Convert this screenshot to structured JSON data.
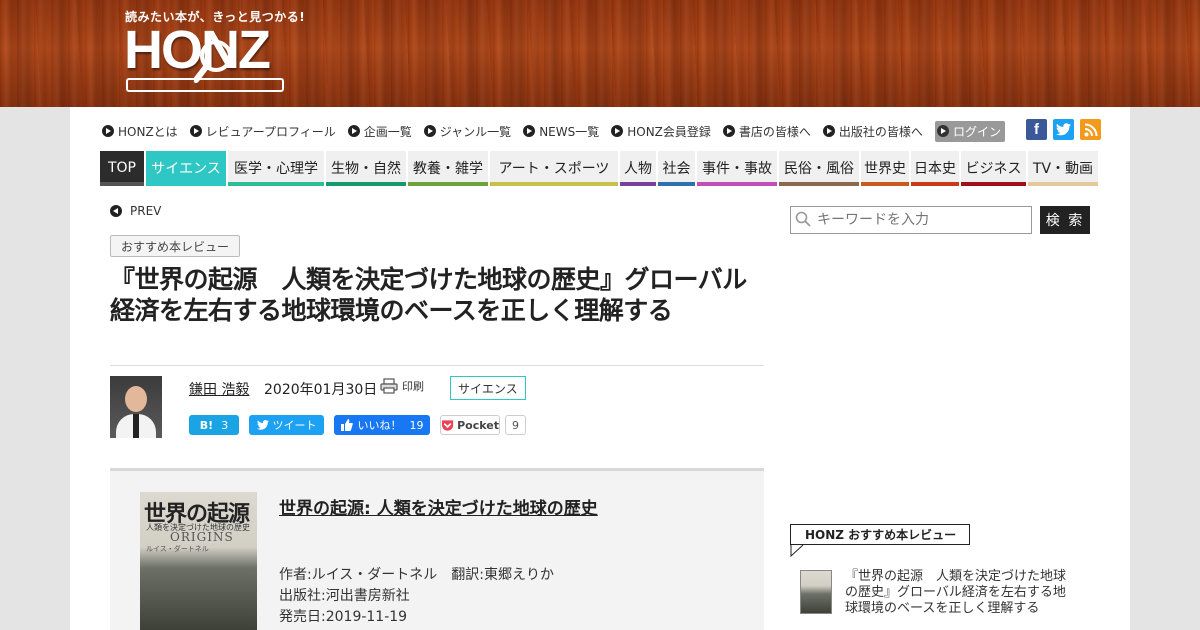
{
  "header": {
    "tagline": "読みたい本が、きっと見つかる!",
    "logo_text": "HONZ"
  },
  "utility_nav": [
    {
      "label": "HONZとは"
    },
    {
      "label": "レビュアープロフィール"
    },
    {
      "label": "企画一覧"
    },
    {
      "label": "ジャンル一覧"
    },
    {
      "label": "NEWS一覧"
    },
    {
      "label": "HONZ会員登録"
    },
    {
      "label": "書店の皆様へ"
    },
    {
      "label": "出版社の皆様へ"
    },
    {
      "label": "ログイン"
    }
  ],
  "social_top": {
    "facebook": "f",
    "twitter": "t",
    "rss": "rss"
  },
  "categories": [
    {
      "label": "TOP",
      "color": "#2c2c2c"
    },
    {
      "label": "サイエンス",
      "color": "#2ec7c3"
    },
    {
      "label": "医学・心理学",
      "color": "#2bbf98"
    },
    {
      "label": "生物・自然",
      "color": "#149a6c"
    },
    {
      "label": "教養・雑学",
      "color": "#6aa33a"
    },
    {
      "label": "アート・スポーツ",
      "color": "#c8c04a"
    },
    {
      "label": "人物",
      "color": "#7a3f96"
    },
    {
      "label": "社会",
      "color": "#2f6fad"
    },
    {
      "label": "事件・事故",
      "color": "#c04fb6"
    },
    {
      "label": "民俗・風俗",
      "color": "#8a6a4a"
    },
    {
      "label": "世界史",
      "color": "#c85a1a"
    },
    {
      "label": "日本史",
      "color": "#c93a1a"
    },
    {
      "label": "ビジネス",
      "color": "#a0101a"
    },
    {
      "label": "TV・動画",
      "color": "#e6c99a"
    }
  ],
  "article": {
    "prev_label": "PREV",
    "badge": "おすすめ本レビュー",
    "title": "『世界の起源　人類を決定づけた地球の歴史』グローバル経済を左右する地球環境のベースを正しく理解する",
    "author": "鎌田 浩毅",
    "date": "2020年01月30日",
    "print_label": "印刷",
    "category_tag": "サイエンス",
    "share": {
      "hatena_label": "B!",
      "hatena_count": "3",
      "tweet_label": "ツイート",
      "like_label": "いいね！",
      "like_count": "19",
      "pocket_label": "Pocket",
      "pocket_count": "9"
    }
  },
  "book": {
    "cover_title": "世界の起源",
    "cover_subtitle": "人類を決定づけた地球の歴史",
    "cover_origins": "ORIGINS",
    "cover_author": "ルイス・ダートネル",
    "title": "世界の起源: 人類を決定づけた地球の歴史",
    "author_line": "作者:ルイス・ダートネル　翻訳:東郷えりか",
    "publisher_line": "出版社:河出書房新社",
    "release_line": "発売日:2019-11-19"
  },
  "sidebar": {
    "search_placeholder": "キーワードを入力",
    "search_button": "検 索",
    "rec_heading": "HONZ おすすめ本レビュー",
    "rec_item_text": "『世界の起源　人類を決定づけた地球の歴史』グローバル経済を左右する地球環境のベースを正しく理解する"
  }
}
